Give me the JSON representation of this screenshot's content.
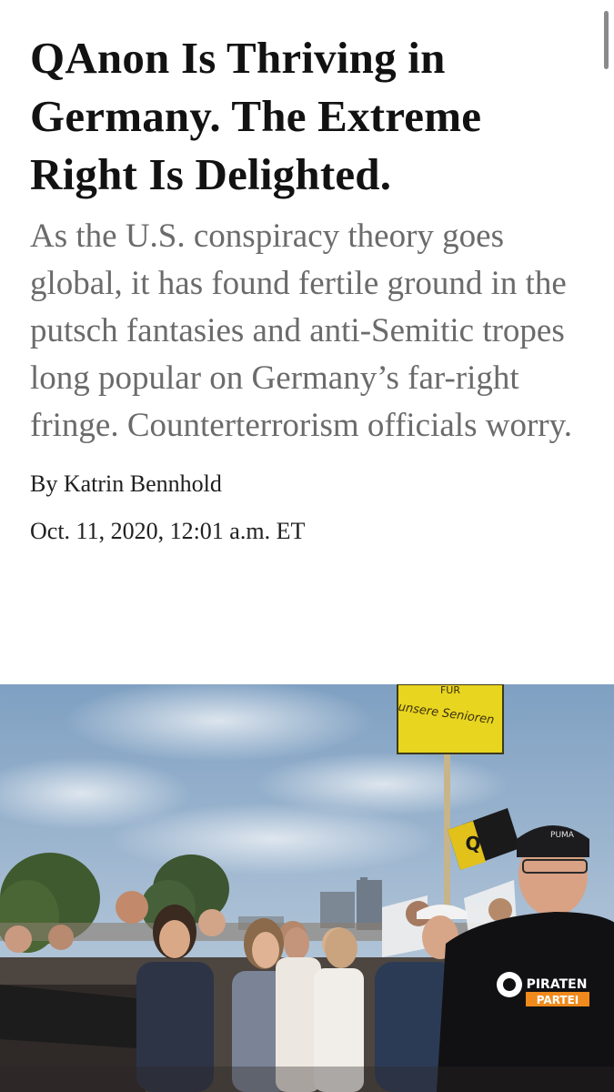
{
  "article": {
    "headline": "QAnon Is Thriving in Germany. The Extreme Right Is Delighted.",
    "summary": "As the U.S. conspiracy theory goes global, it has found fertile ground in the putsch fantasies and anti-Semitic tropes long popular on Germany’s far-right fringe. Counterterrorism officials worry.",
    "byline": "By Katrin Bennhold",
    "dateline": "Oct. 11, 2020, 12:01 a.m. ET"
  },
  "photo": {
    "sign_text_line1": "FUR",
    "sign_text_line2": "unsere Senioren",
    "flag_letter": "Q",
    "cap_text": "PUMA",
    "shirt_text_line1": "PIRATEN",
    "shirt_text_line2": "PARTEI"
  },
  "colors": {
    "headline": "#121212",
    "summary": "#6b6b6b",
    "sign_yellow": "#e8d51f",
    "flag_yellow": "#e2c11b",
    "sky": "#9db6cf",
    "shirt_logo_orange": "#f08a1c"
  }
}
